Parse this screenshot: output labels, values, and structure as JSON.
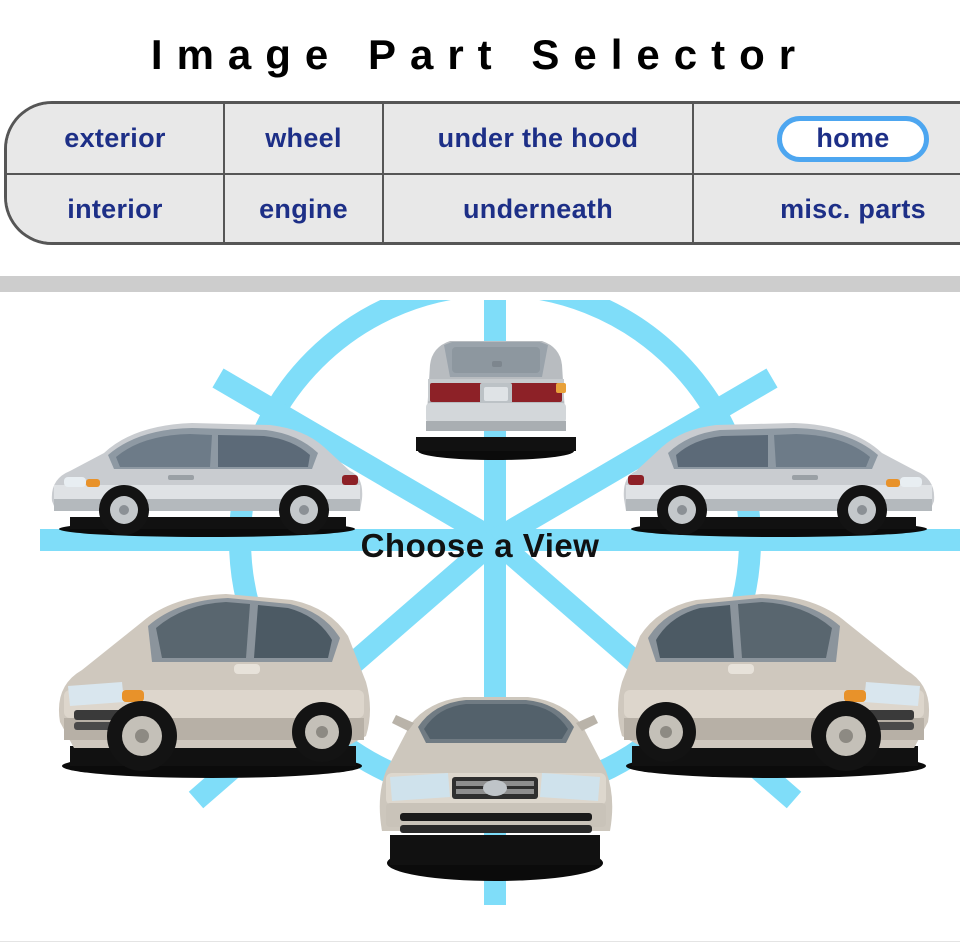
{
  "page": {
    "title": "Image Part Selector",
    "background_color": "#ffffff"
  },
  "nav": {
    "name": "part-category-nav",
    "border_color": "#565656",
    "cell_background": "#e8e8e8",
    "label_color": "#1d2f87",
    "active_item": "home",
    "active_pill_border_color": "#4da6f0",
    "active_pill_background": "#ffffff",
    "rows": [
      [
        {
          "label": "exterior",
          "active": false
        },
        {
          "label": "wheel",
          "active": false
        },
        {
          "label": "under the hood",
          "active": false
        },
        {
          "label": "home",
          "active": true
        }
      ],
      [
        {
          "label": "interior",
          "active": false
        },
        {
          "label": "engine",
          "active": false
        },
        {
          "label": "underneath",
          "active": false
        },
        {
          "label": "misc. parts",
          "active": false
        }
      ]
    ]
  },
  "divider": {
    "color": "#cdcdcd"
  },
  "selector": {
    "center_label": "Choose a View",
    "burst_color": "#7fddf9",
    "ring_color": "#7fddf9",
    "car_body_color": "#cfc8be",
    "views": [
      {
        "name": "rear-view",
        "position": "top-center"
      },
      {
        "name": "rear-left-side-view",
        "position": "left-upper"
      },
      {
        "name": "rear-right-side-view",
        "position": "right-upper"
      },
      {
        "name": "front-left-three-quarter-view",
        "position": "left-lower"
      },
      {
        "name": "front-right-three-quarter-view",
        "position": "right-lower"
      },
      {
        "name": "front-view",
        "position": "bottom-center"
      }
    ]
  },
  "footer": {
    "rule_color": "#e4e4e4"
  }
}
